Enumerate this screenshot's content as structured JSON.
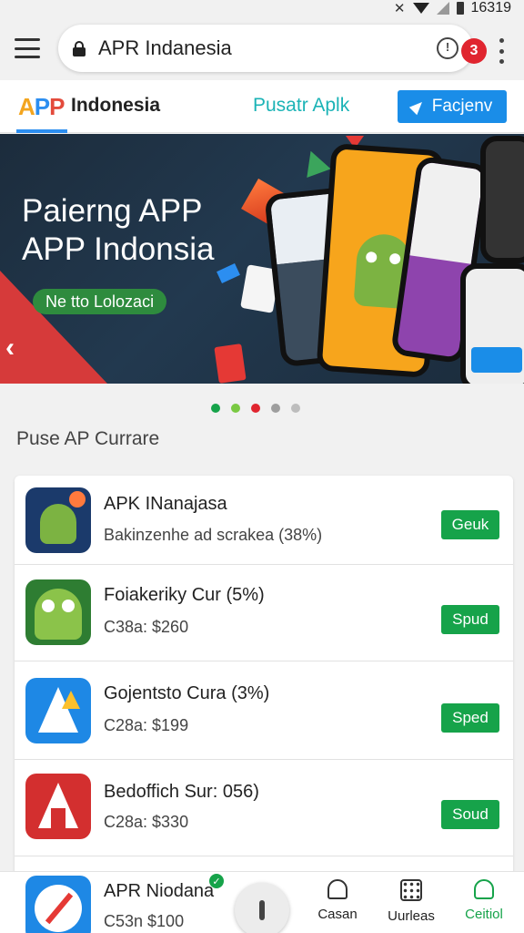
{
  "status_bar": {
    "time": "16319"
  },
  "browser": {
    "url_text": "APR Indanesia",
    "notification_count": "3"
  },
  "site_header": {
    "logo": {
      "a": "A",
      "p1": "P",
      "p2": "P"
    },
    "site_name": "Indonesia",
    "nav_link": "Pusatr Aplk",
    "cta_label": "Facjenv"
  },
  "banner": {
    "title_line1": "Paierng APP",
    "title_line2": "APP Indonsia",
    "pill_label": "Ne tto Lolozaci",
    "dots": 5,
    "active_dot": 2
  },
  "section": {
    "title": "Puse AP Currare"
  },
  "apps": [
    {
      "title": "APK INanajasa",
      "subtitle": "Bakinzenhe ad scrakea (38%)",
      "button": "Geuk",
      "icon": "android-mascot-icon"
    },
    {
      "title": "Foiakeriky Cur (5%)",
      "subtitle": "C38a: $260",
      "button": "Spud",
      "icon": "android-green-icon"
    },
    {
      "title": "Gojentsto Cura (3%)",
      "subtitle": "C28a: $199",
      "button": "Sped",
      "icon": "blue-a-icon"
    },
    {
      "title": "Bedoffich Sur: 056)",
      "subtitle": "C28a: $330",
      "button": "Soud",
      "icon": "red-a-icon"
    }
  ],
  "bottom_bar": {
    "app_title": "APR Niodana",
    "app_subtitle": "C53n $100",
    "nav": [
      {
        "label": "Casan",
        "icon": "bell-icon"
      },
      {
        "label": "Uurleas",
        "icon": "grid-icon"
      },
      {
        "label": "Ceitiol",
        "icon": "person-icon"
      }
    ]
  },
  "colors": {
    "accent_blue": "#1a8de8",
    "teal_link": "#1bb3b6",
    "button_green": "#16a34a",
    "badge_red": "#e0252f",
    "dot_colors": [
      "#16a34a",
      "#7ac943",
      "#e0252f",
      "#9e9e9e",
      "#bdbdbd"
    ]
  }
}
